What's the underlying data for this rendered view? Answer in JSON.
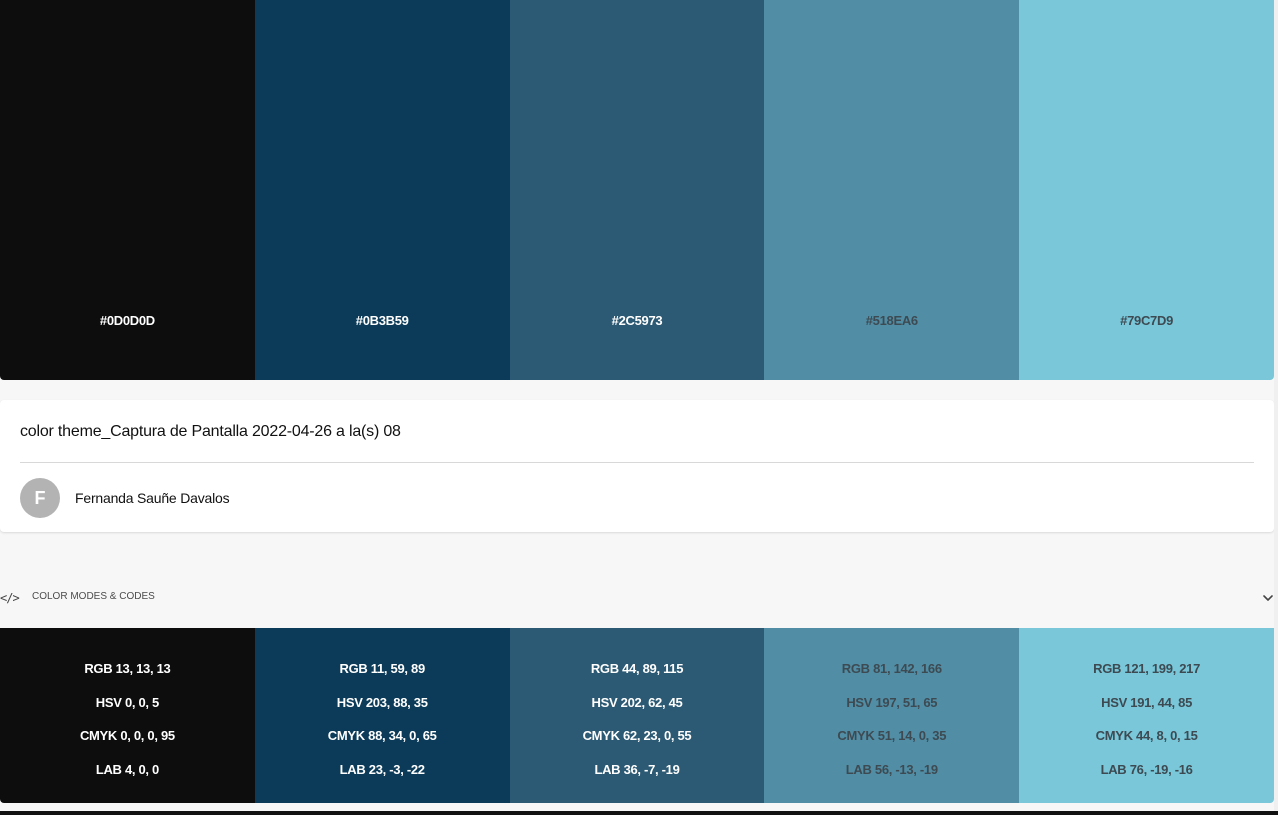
{
  "palette": {
    "swatches": [
      {
        "hex": "#0D0D0D",
        "color": "#0d0d0d",
        "text_color": "#ffffff"
      },
      {
        "hex": "#0B3B59",
        "color": "#0b3b59",
        "text_color": "#ffffff"
      },
      {
        "hex": "#2C5973",
        "color": "#2c5973",
        "text_color": "#ffffff"
      },
      {
        "hex": "#518EA6",
        "color": "#518ea6",
        "text_color": "#3d4a52"
      },
      {
        "hex": "#79C7D9",
        "color": "#79c7d9",
        "text_color": "#3d4a52"
      }
    ]
  },
  "theme": {
    "title": "color theme_Captura de Pantalla 2022-04-26 a la(s) 08",
    "author_initial": "F",
    "author_name": "Fernanda Sauñe Davalos"
  },
  "codes_section": {
    "icon_glyph": "</>",
    "label": "COLOR MODES & CODES"
  },
  "codes": [
    {
      "rgb": "RGB 13, 13, 13",
      "hsv": "HSV 0, 0, 5",
      "cmyk": "CMYK 0, 0, 0, 95",
      "lab": "LAB 4, 0, 0"
    },
    {
      "rgb": "RGB 11, 59, 89",
      "hsv": "HSV 203, 88, 35",
      "cmyk": "CMYK 88, 34, 0, 65",
      "lab": "LAB 23, -3, -22"
    },
    {
      "rgb": "RGB 44, 89, 115",
      "hsv": "HSV 202, 62, 45",
      "cmyk": "CMYK 62, 23, 0, 55",
      "lab": "LAB 36, -7, -19"
    },
    {
      "rgb": "RGB 81, 142, 166",
      "hsv": "HSV 197, 51, 65",
      "cmyk": "CMYK 51, 14, 0, 35",
      "lab": "LAB 56, -13, -19"
    },
    {
      "rgb": "RGB 121, 199, 217",
      "hsv": "HSV 191, 44, 85",
      "cmyk": "CMYK 44, 8, 0, 15",
      "lab": "LAB 76, -19, -16"
    }
  ],
  "icons": {
    "code": "code-icon",
    "chevron": "chevron-down-icon"
  }
}
